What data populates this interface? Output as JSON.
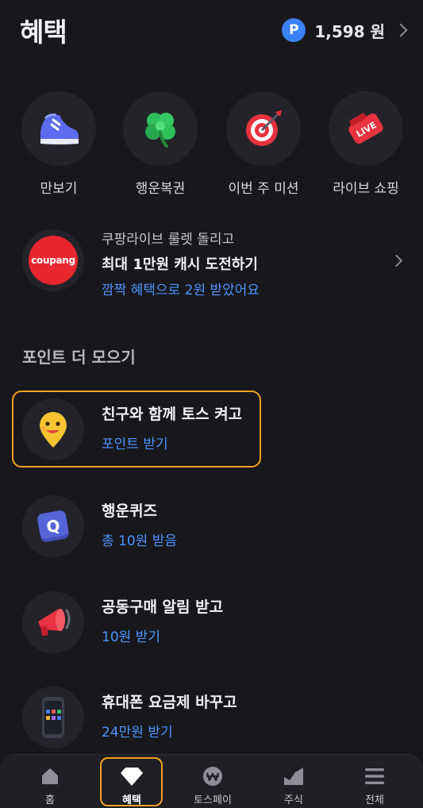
{
  "header": {
    "title": "혜택",
    "points_symbol": "P",
    "points_value": "1,598 원"
  },
  "quick_items": [
    {
      "label": "만보기",
      "icon": "sneaker-icon"
    },
    {
      "label": "행운복권",
      "icon": "clover-icon"
    },
    {
      "label": "이번 주 미션",
      "icon": "target-icon"
    },
    {
      "label": "라이브 쇼핑",
      "icon": "live-tag-icon"
    }
  ],
  "promo": {
    "logo_text": "coupang",
    "subtitle": "쿠팡라이브 룰렛 돌리고",
    "title": "최대 1만원 캐시 도전하기",
    "link": "깜짝 혜택으로 2원 받았어요"
  },
  "section": {
    "title": "포인트 더 모으기"
  },
  "earn_items": [
    {
      "title": "친구와 함께 토스 켜고",
      "sub": "포인트 받기",
      "icon": "smiley-pin-icon"
    },
    {
      "title": "행운퀴즈",
      "sub": "총 10원 받음",
      "icon": "quiz-q-icon"
    },
    {
      "title": "공동구매 알림 받고",
      "sub": "10원 받기",
      "icon": "megaphone-icon"
    },
    {
      "title": "휴대폰 요금제 바꾸고",
      "sub": "24만원 받기",
      "icon": "phone-icon"
    }
  ],
  "tabbar": {
    "items": [
      {
        "label": "홈",
        "icon": "home-icon"
      },
      {
        "label": "혜택",
        "icon": "gem-icon",
        "active": true
      },
      {
        "label": "토스페이",
        "icon": "pay-won-icon"
      },
      {
        "label": "주식",
        "icon": "stock-chart-icon"
      },
      {
        "label": "전체",
        "icon": "menu-icon"
      }
    ]
  },
  "colors": {
    "background": "#17171c",
    "accent_blue": "#4e95ff",
    "highlight_orange": "#f5a023",
    "coupang_red": "#e8262f"
  }
}
